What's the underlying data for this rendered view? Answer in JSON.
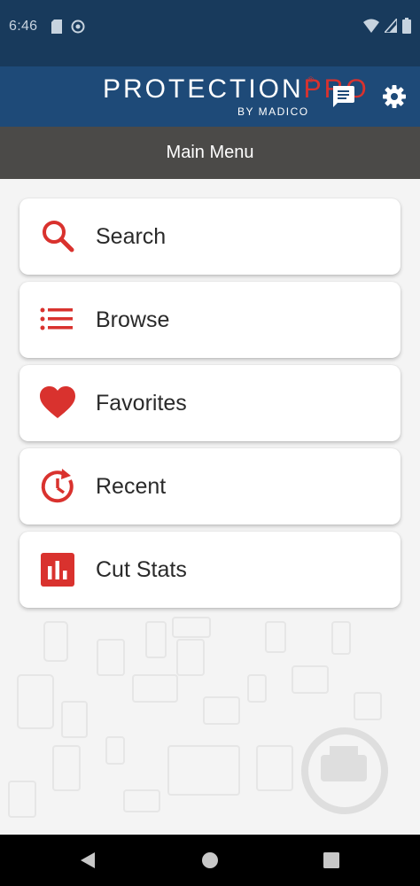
{
  "status_bar": {
    "time": "6:46",
    "left_icons": [
      "sd-card-icon",
      "sync-icon"
    ],
    "right_icons": [
      "wifi-icon",
      "signal-icon",
      "battery-icon"
    ]
  },
  "app_bar": {
    "logo_main": "PROTECTION",
    "logo_accent": "PRO",
    "logo_registered": "®",
    "logo_sub": "BY MADICO",
    "actions": [
      "chat-icon",
      "gear-icon"
    ]
  },
  "subheader": {
    "title": "Main Menu"
  },
  "menu": {
    "items": [
      {
        "label": "Search",
        "icon": "search-icon"
      },
      {
        "label": "Browse",
        "icon": "list-icon"
      },
      {
        "label": "Favorites",
        "icon": "heart-icon"
      },
      {
        "label": "Recent",
        "icon": "history-icon"
      },
      {
        "label": "Cut Stats",
        "icon": "bar-chart-icon"
      }
    ]
  },
  "nav_bar": {
    "buttons": [
      "back-icon",
      "home-icon",
      "recents-icon"
    ]
  },
  "colors": {
    "status_bar_bg": "#183a5c",
    "app_bar_bg": "#1e4a78",
    "subheader_bg": "#4b4a48",
    "accent_red": "#d9322e",
    "content_bg": "#f4f4f4",
    "card_bg": "#ffffff"
  }
}
